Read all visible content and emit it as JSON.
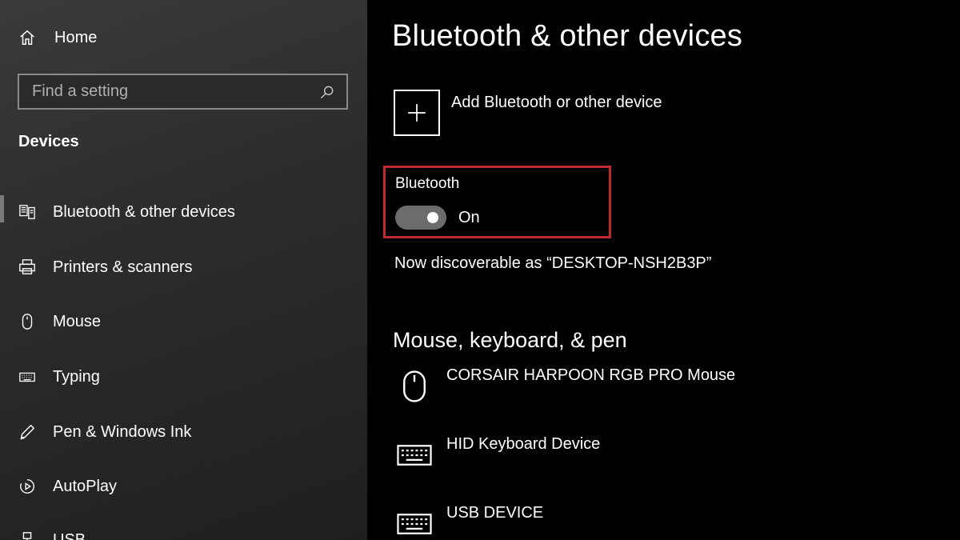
{
  "sidebar": {
    "home_label": "Home",
    "search_placeholder": "Find a setting",
    "section_title": "Devices",
    "items": [
      {
        "label": "Bluetooth & other devices",
        "icon": "bluetooth-devices-icon"
      },
      {
        "label": "Printers & scanners",
        "icon": "printer-icon"
      },
      {
        "label": "Mouse",
        "icon": "mouse-icon"
      },
      {
        "label": "Typing",
        "icon": "keyboard-icon"
      },
      {
        "label": "Pen & Windows Ink",
        "icon": "pen-icon"
      },
      {
        "label": "AutoPlay",
        "icon": "autoplay-icon"
      },
      {
        "label": "USB",
        "icon": "usb-icon"
      }
    ]
  },
  "main": {
    "title": "Bluetooth & other devices",
    "add_device_label": "Add Bluetooth or other device",
    "bluetooth": {
      "label": "Bluetooth",
      "state": "On",
      "enabled": true
    },
    "discoverable_text": "Now discoverable as “DESKTOP-NSH2B3P”",
    "mouse_group": {
      "title": "Mouse, keyboard, & pen",
      "devices": [
        {
          "name": "CORSAIR HARPOON RGB PRO Mouse",
          "icon": "mouse-icon"
        },
        {
          "name": "HID Keyboard Device",
          "icon": "keyboard-icon"
        },
        {
          "name": "USB DEVICE",
          "icon": "keyboard-icon"
        }
      ]
    }
  },
  "colors": {
    "sidebar_top": "#3a3a3a",
    "main_background": "#000000",
    "highlight_border": "#c0292f",
    "toggle_track": "#6c6c6c",
    "text": "#ffffff"
  }
}
